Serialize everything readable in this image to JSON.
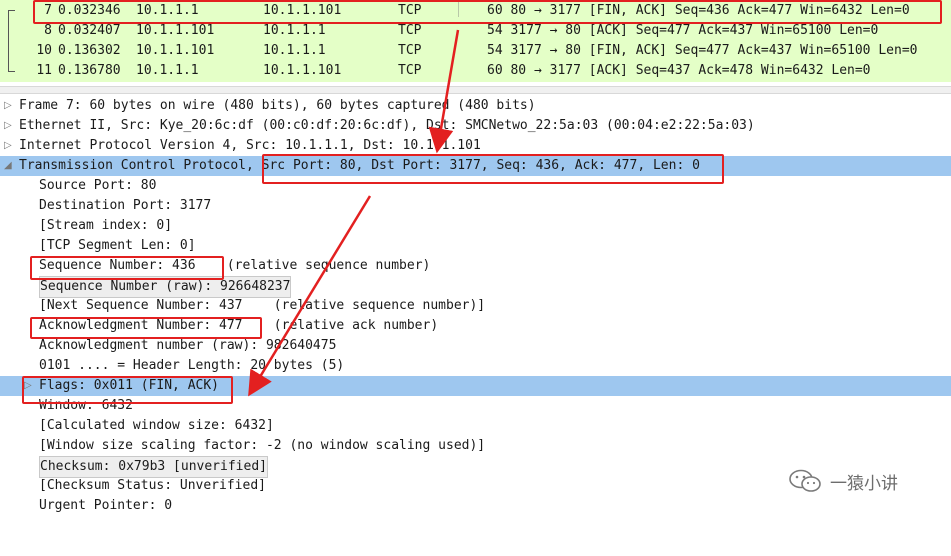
{
  "packets": [
    {
      "no": "7",
      "time": "0.032346",
      "src": "10.1.1.1",
      "dst": "10.1.1.101",
      "proto": "TCP",
      "info": "60 80 → 3177 [FIN, ACK] Seq=436 Ack=477 Win=6432 Len=0"
    },
    {
      "no": "8",
      "time": "0.032407",
      "src": "10.1.1.101",
      "dst": "10.1.1.1",
      "proto": "TCP",
      "info": "54 3177 → 80 [ACK] Seq=477 Ack=437 Win=65100 Len=0"
    },
    {
      "no": "10",
      "time": "0.136302",
      "src": "10.1.1.101",
      "dst": "10.1.1.1",
      "proto": "TCP",
      "info": "54 3177 → 80 [FIN, ACK] Seq=477 Ack=437 Win=65100 Len=0"
    },
    {
      "no": "11",
      "time": "0.136780",
      "src": "10.1.1.1",
      "dst": "10.1.1.101",
      "proto": "TCP",
      "info": "60 80 → 3177 [ACK] Seq=437 Ack=478 Win=6432 Len=0"
    }
  ],
  "tree": {
    "frame": "Frame 7: 60 bytes on wire (480 bits), 60 bytes captured (480 bits)",
    "ethernet": "Ethernet II, Src: Kye_20:6c:df (00:c0:df:20:6c:df), Dst: SMCNetwo_22:5a:03 (00:04:e2:22:5a:03)",
    "ip": "Internet Protocol Version 4, Src: 10.1.1.1, Dst: 10.1.1.101",
    "tcp_prefix": "Transmission Control Protocol, ",
    "tcp_summary": "Src Port: 80, Dst Port: 3177, Seq: 436, Ack: 477, Len: 0",
    "source_port": "Source Port: 80",
    "dest_port": "Destination Port: 3177",
    "stream_index": "[Stream index: 0]",
    "segment_len": "[TCP Segment Len: 0]",
    "seq_num": "Sequence Number: 436",
    "seq_note": "    (relative sequence number)",
    "seq_raw": "Sequence Number (raw): 926648237",
    "next_seq": "[Next Sequence Number: 437    (relative sequence number)]",
    "ack_num": "Acknowledgment Number: 477",
    "ack_note": "    (relative ack number)",
    "ack_raw": "Acknowledgment number (raw): 982640475",
    "header_len": "0101 .... = Header Length: 20 bytes (5)",
    "flags": "Flags: 0x011 (FIN, ACK)",
    "window": "Window: 6432",
    "calc_window": "[Calculated window size: 6432]",
    "window_scaling": "[Window size scaling factor: -2 (no window scaling used)]",
    "checksum": "Checksum: 0x79b3 [unverified]",
    "checksum_status": "[Checksum Status: Unverified]",
    "urgent": "Urgent Pointer: 0"
  },
  "watermark": "一猿小讲",
  "colors": {
    "packet_bg": "#e4ffc7",
    "selected_row": "#9ec7ef",
    "annotation": "#e32020"
  }
}
